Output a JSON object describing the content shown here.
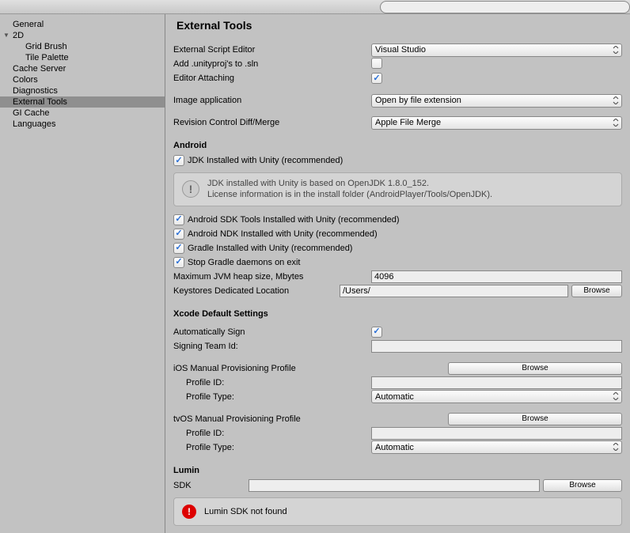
{
  "search": {
    "placeholder": ""
  },
  "sidebar": {
    "general": "General",
    "twod": "2D",
    "gridbrush": "Grid Brush",
    "tilepalette": "Tile Palette",
    "cacheserver": "Cache Server",
    "colors": "Colors",
    "diagnostics": "Diagnostics",
    "externaltools": "External Tools",
    "gicache": "GI Cache",
    "languages": "Languages"
  },
  "title": "External Tools",
  "labels": {
    "extEditor": "External Script Editor",
    "addProj": "Add .unityproj's to .sln",
    "editorAttach": "Editor Attaching",
    "imageApp": "Image application",
    "revControl": "Revision Control Diff/Merge",
    "android": "Android",
    "jdk": "JDK Installed with Unity (recommended)",
    "jdkInfo1": "JDK installed with Unity is based on OpenJDK 1.8.0_152.",
    "jdkInfo2": "License information is in the install folder (AndroidPlayer/Tools/OpenJDK).",
    "asdk": "Android SDK Tools Installed with Unity (recommended)",
    "andk": "Android NDK Installed with Unity (recommended)",
    "gradle": "Gradle Installed with Unity (recommended)",
    "stopGradle": "Stop Gradle daemons on exit",
    "jvmHeap": "Maximum JVM heap size, Mbytes",
    "keystore": "Keystores Dedicated Location",
    "xcode": "Xcode Default Settings",
    "autoSign": "Automatically Sign",
    "teamId": "Signing Team Id:",
    "iosProf": "iOS Manual Provisioning Profile",
    "profId": "Profile ID:",
    "profType": "Profile Type:",
    "tvosProf": "tvOS Manual Provisioning Profile",
    "lumin": "Lumin",
    "sdk": "SDK",
    "luminErr": "Lumin SDK not found",
    "browse": "Browse"
  },
  "values": {
    "editor": "Visual Studio",
    "imageApp": "Open by file extension",
    "revControl": "Apple File Merge",
    "jvmHeap": "4096",
    "keystore": "/Users/",
    "profType": "Automatic"
  }
}
